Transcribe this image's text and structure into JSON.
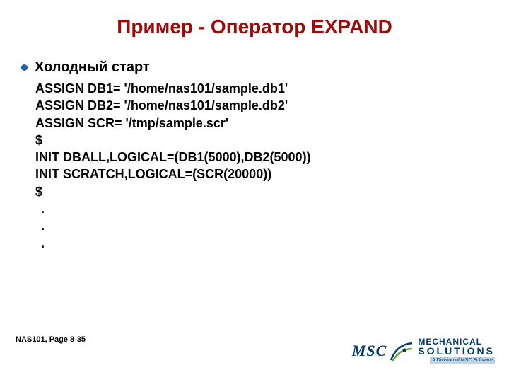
{
  "title": "Пример - Оператор EXPAND",
  "bullet": "Холодный старт",
  "code": {
    "l1": "ASSIGN DB1= '/home/nas101/sample.db1'",
    "l2": "ASSIGN DB2= '/home/nas101/sample.db2'",
    "l3": "ASSIGN SCR= '/tmp/sample.scr'",
    "l4": "$",
    "l5": "INIT DBALL,LOGICAL=(DB1(5000),DB2(5000))",
    "l6": "INIT SCRATCH,LOGICAL=(SCR(20000))",
    "l7": "$"
  },
  "dots": {
    "d1": ".",
    "d2": ".",
    "d3": "."
  },
  "footer": "NAS101, Page 8-35",
  "logo": {
    "msc": "MSC",
    "mech": "MECHANICAL",
    "sol": "SOLUTIONS",
    "div": "A Division of MSC.Software"
  }
}
